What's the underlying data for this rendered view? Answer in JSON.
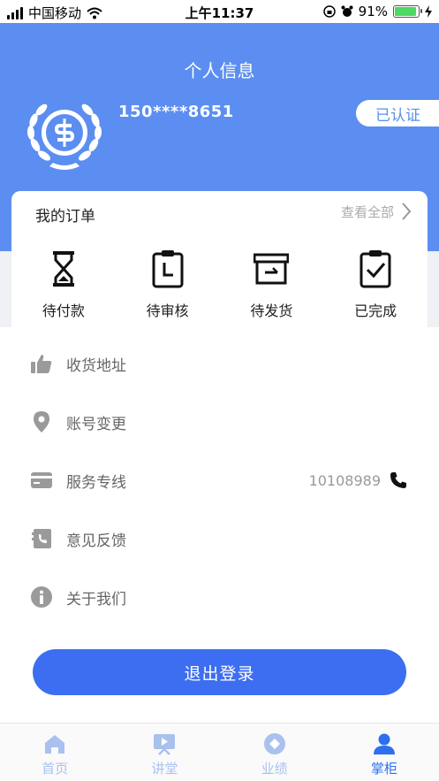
{
  "status_bar": {
    "carrier": "中国移动",
    "time": "上午11:37",
    "battery": "91%",
    "battery_level": 0.91
  },
  "header": {
    "title": "个人信息",
    "phone": "150****8651",
    "verify_badge": "已认证"
  },
  "orders": {
    "title": "我的订单",
    "view_all": "查看全部",
    "items": [
      {
        "label": "待付款",
        "icon": "hourglass-icon"
      },
      {
        "label": "待审核",
        "icon": "clipboard-clock-icon"
      },
      {
        "label": "待发货",
        "icon": "archive-box-icon"
      },
      {
        "label": "已完成",
        "icon": "clipboard-check-icon"
      }
    ]
  },
  "menu": {
    "items": [
      {
        "label": "收货地址",
        "icon": "thumbs-up-icon"
      },
      {
        "label": "账号变更",
        "icon": "location-pin-icon"
      },
      {
        "label": "服务专线",
        "icon": "card-icon",
        "value": "10108989"
      },
      {
        "label": "意见反馈",
        "icon": "feedback-icon"
      },
      {
        "label": "关于我们",
        "icon": "info-icon"
      }
    ]
  },
  "logout_label": "退出登录",
  "tabs": [
    {
      "label": "首页",
      "icon": "home-icon"
    },
    {
      "label": "讲堂",
      "icon": "video-icon"
    },
    {
      "label": "业绩",
      "icon": "performance-icon"
    },
    {
      "label": "掌柜",
      "icon": "user-icon",
      "active": true
    }
  ],
  "colors": {
    "header_bg": "#5b8ef0",
    "logout_bg": "#3d6ef2",
    "tab_active": "#2e6ff0",
    "tab_inactive": "#a9c1ef"
  }
}
